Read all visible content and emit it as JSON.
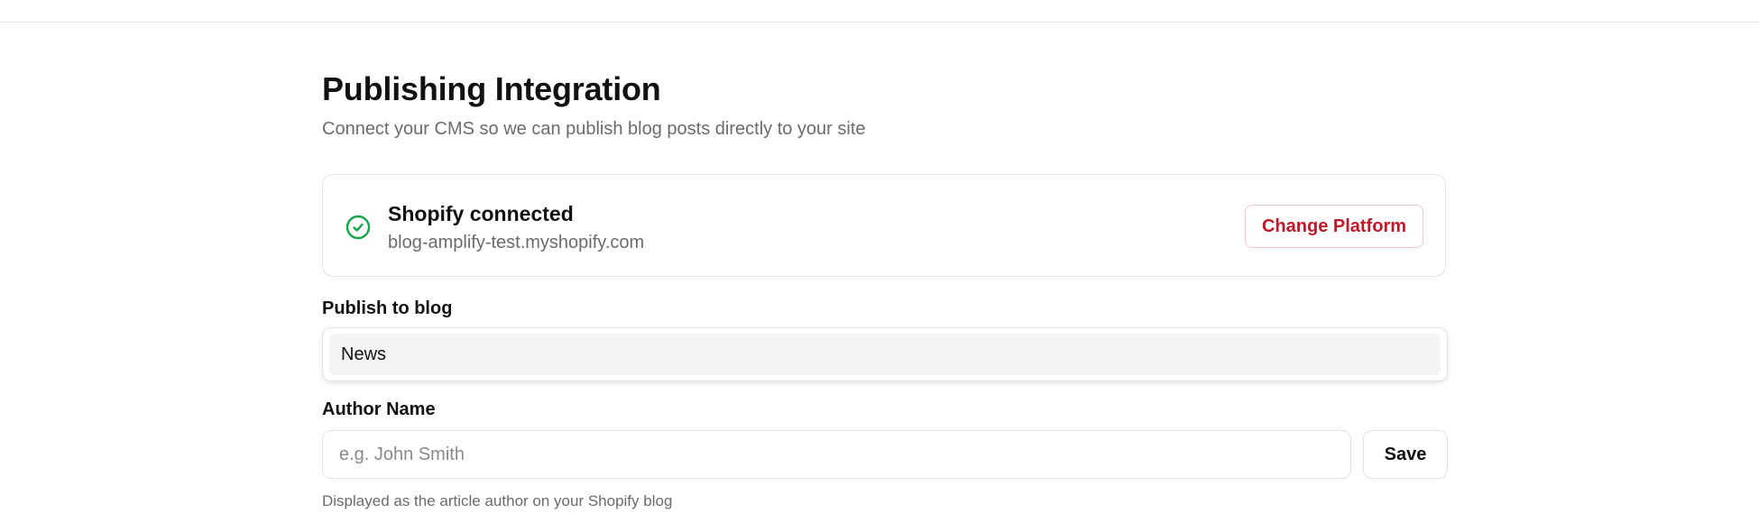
{
  "header": {
    "title": "Publishing Integration",
    "subtitle": "Connect your CMS so we can publish blog posts directly to your site"
  },
  "connection": {
    "status_icon": "check-circle-icon",
    "status_color": "#16a34a",
    "title": "Shopify connected",
    "domain": "blog-amplify-test.myshopify.com",
    "change_button_label": "Change Platform",
    "change_button_color": "#c0182a"
  },
  "blog_select": {
    "label": "Publish to blog",
    "selected_value": "News"
  },
  "author": {
    "label": "Author Name",
    "placeholder": "e.g. John Smith",
    "value": "",
    "save_button_label": "Save",
    "help_text": "Displayed as the article author on your Shopify blog"
  }
}
